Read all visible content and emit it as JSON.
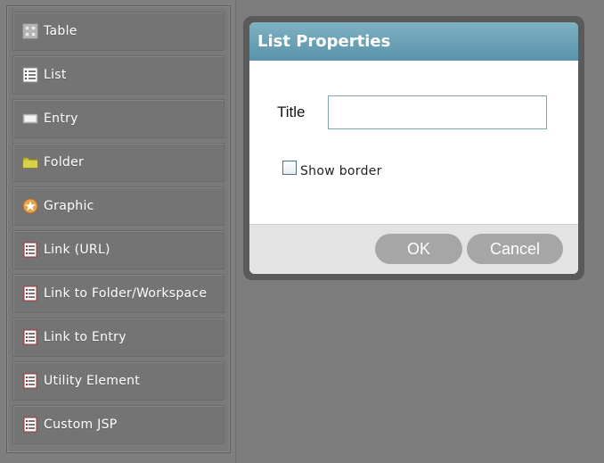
{
  "palette": {
    "items": [
      {
        "label": "Table",
        "icon": "table-icon"
      },
      {
        "label": "List",
        "icon": "list-icon"
      },
      {
        "label": "Entry",
        "icon": "entry-icon"
      },
      {
        "label": "Folder",
        "icon": "folder-icon"
      },
      {
        "label": "Graphic",
        "icon": "graphic-icon"
      },
      {
        "label": "Link (URL)",
        "icon": "link-url-icon"
      },
      {
        "label": "Link to Folder/Workspace",
        "icon": "link-folder-icon"
      },
      {
        "label": "Link to Entry",
        "icon": "link-entry-icon"
      },
      {
        "label": "Utility Element",
        "icon": "utility-element-icon"
      },
      {
        "label": "Custom JSP",
        "icon": "custom-jsp-icon"
      }
    ]
  },
  "dialog": {
    "title": "List Properties",
    "title_field_label": "Title",
    "title_field_value": "",
    "show_border_label": "Show border",
    "show_border_checked": false,
    "ok_label": "OK",
    "cancel_label": "Cancel",
    "header_color": "#6aa1b6"
  }
}
